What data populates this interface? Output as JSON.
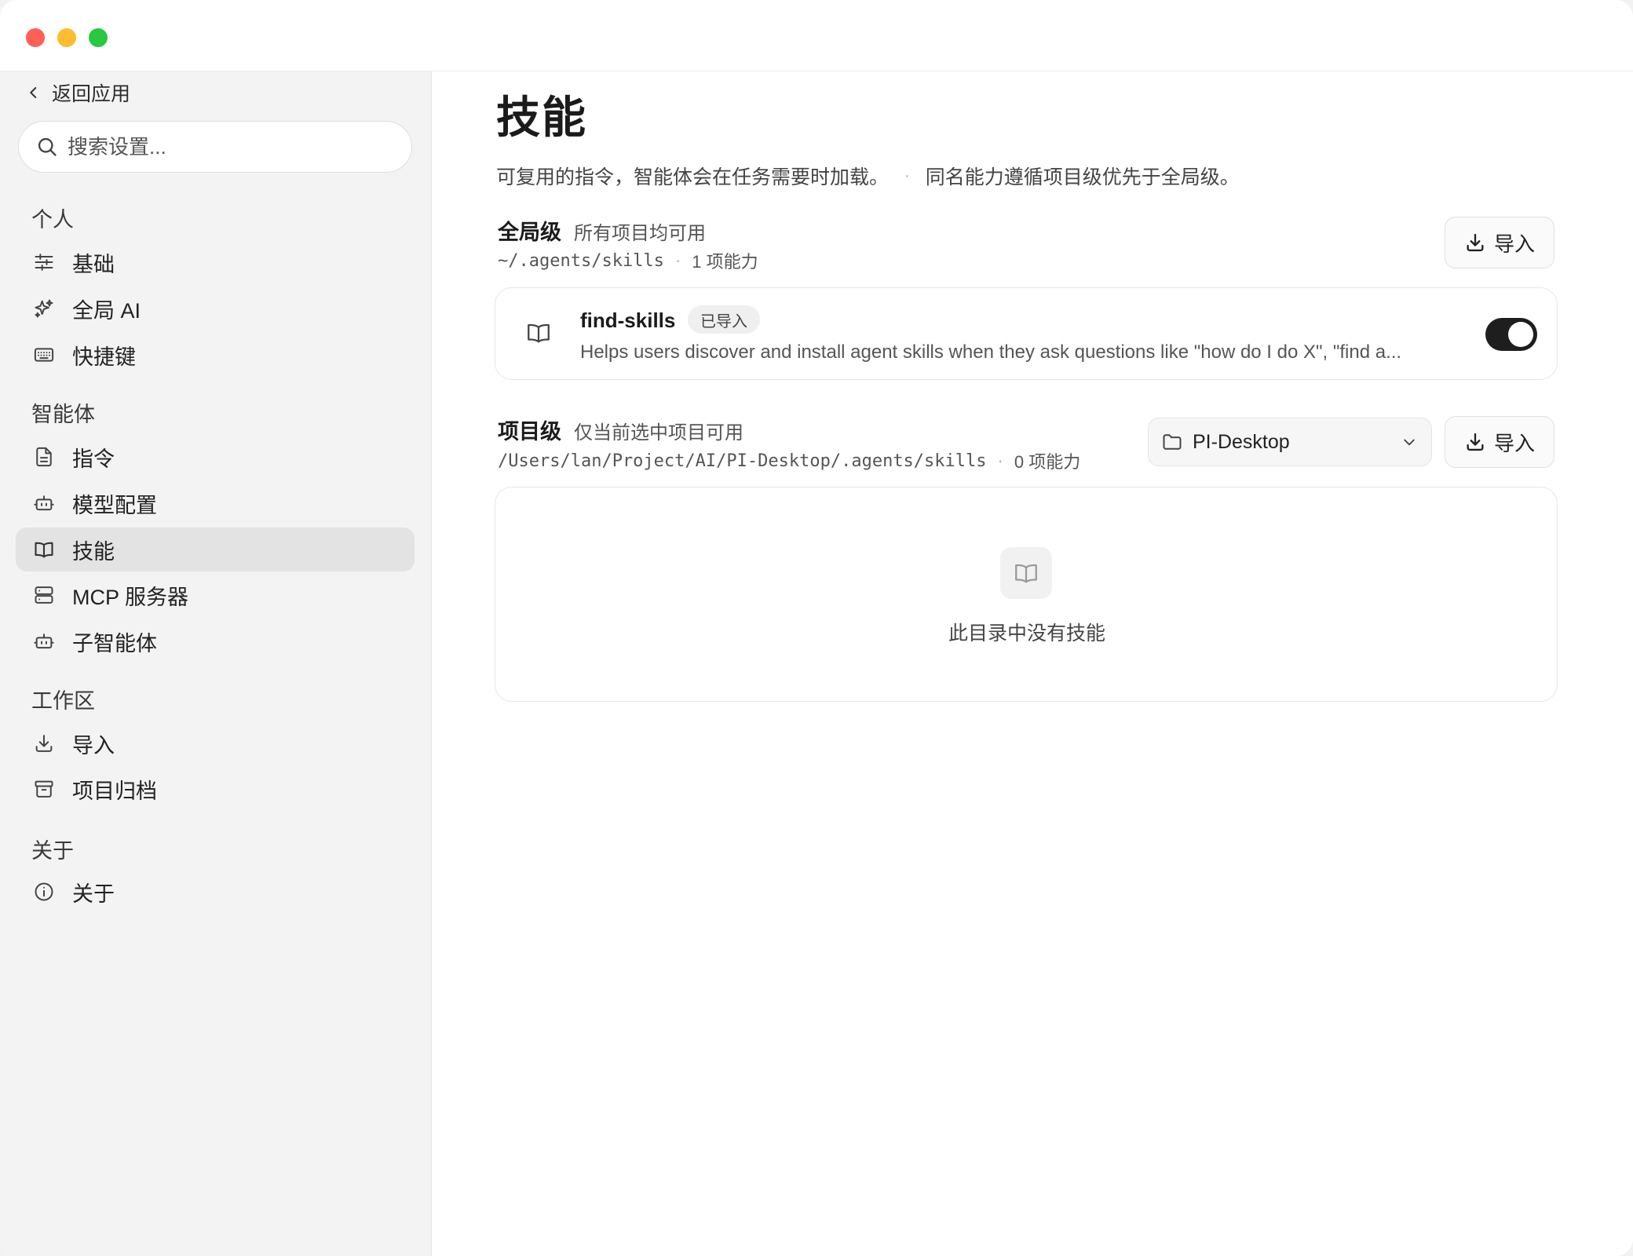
{
  "sidebar": {
    "back_label": "返回应用",
    "search_placeholder": "搜索设置...",
    "sections": [
      {
        "title": "个人",
        "items": [
          {
            "label": "基础",
            "icon": "sliders-icon"
          },
          {
            "label": "全局 AI",
            "icon": "sparkles-icon"
          },
          {
            "label": "快捷键",
            "icon": "keyboard-icon"
          }
        ]
      },
      {
        "title": "智能体",
        "items": [
          {
            "label": "指令",
            "icon": "document-icon"
          },
          {
            "label": "模型配置",
            "icon": "robot-icon"
          },
          {
            "label": "技能",
            "icon": "book-icon",
            "active": true
          },
          {
            "label": "MCP 服务器",
            "icon": "server-icon"
          },
          {
            "label": "子智能体",
            "icon": "robot-icon"
          }
        ]
      },
      {
        "title": "工作区",
        "items": [
          {
            "label": "导入",
            "icon": "download-icon"
          },
          {
            "label": "项目归档",
            "icon": "archive-icon"
          }
        ]
      },
      {
        "title": "关于",
        "items": [
          {
            "label": "关于",
            "icon": "info-icon"
          }
        ]
      }
    ]
  },
  "main": {
    "title": "技能",
    "description": "可复用的指令，智能体会在任务需要时加载。",
    "description_sep": "·",
    "description_note": "同名能力遵循项目级优先于全局级。",
    "global": {
      "name": "全局级",
      "subtitle": "所有项目均可用",
      "path": "~/.agents/skills",
      "sep": "·",
      "count": "1 项能力",
      "import_label": "导入",
      "skills": [
        {
          "name": "find-skills",
          "badge": "已导入",
          "description": "Helps users discover and install agent skills when they ask questions like \"how do I do X\", \"find a...",
          "enabled": true
        }
      ]
    },
    "project": {
      "name": "项目级",
      "subtitle": "仅当前选中项目可用",
      "path": "/Users/lan/Project/AI/PI-Desktop/.agents/skills",
      "sep": "·",
      "count": "0 项能力",
      "selected_project": "PI-Desktop",
      "import_label": "导入",
      "empty_text": "此目录中没有技能"
    }
  },
  "colors": {
    "traffic_close": "#fe5f57",
    "traffic_min": "#febc2e",
    "traffic_max": "#28c840",
    "toggle_on": "#1e1e1e",
    "sidebar_bg": "#f3f3f3",
    "active_item_bg": "#e3e3e3"
  }
}
